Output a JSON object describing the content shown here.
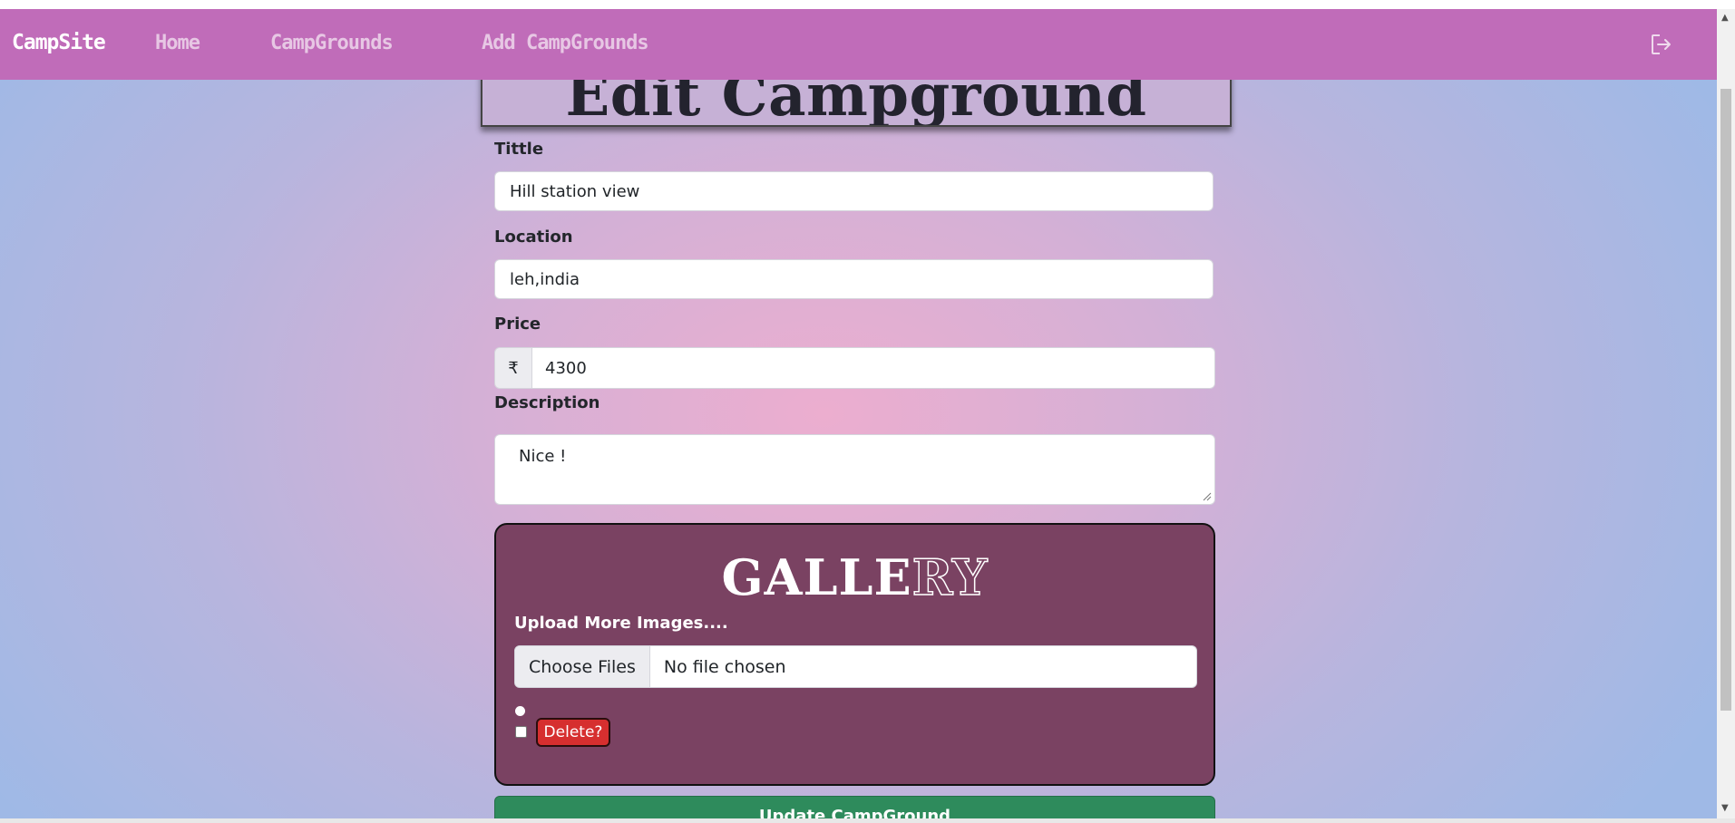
{
  "navbar": {
    "brand": "CampSite",
    "links": [
      "Home",
      "CampGrounds",
      "Add CampGrounds"
    ],
    "logout_icon": "logout-icon"
  },
  "page": {
    "title": "Edit Campground"
  },
  "form": {
    "title_label": "Tittle",
    "title_value": "Hill station view",
    "location_label": "Location",
    "location_value": "leh,india",
    "price_label": "Price",
    "price_prefix": "₹",
    "price_value": "4300",
    "description_label": "Description",
    "description_value": "Nice !"
  },
  "gallery": {
    "title_solid": "GALLE",
    "title_outline": "RY",
    "upload_label": "Upload More Images....",
    "choose_files_label": "Choose Files",
    "no_file_text": "No file chosen",
    "delete_label": "Delete?"
  },
  "actions": {
    "update_label": "Update CampGround"
  },
  "colors": {
    "navbar": "#c06cb9",
    "gallery_bg": "#7a4262",
    "delete_btn": "#d62f2f",
    "update_btn": "#2e8b5c"
  }
}
